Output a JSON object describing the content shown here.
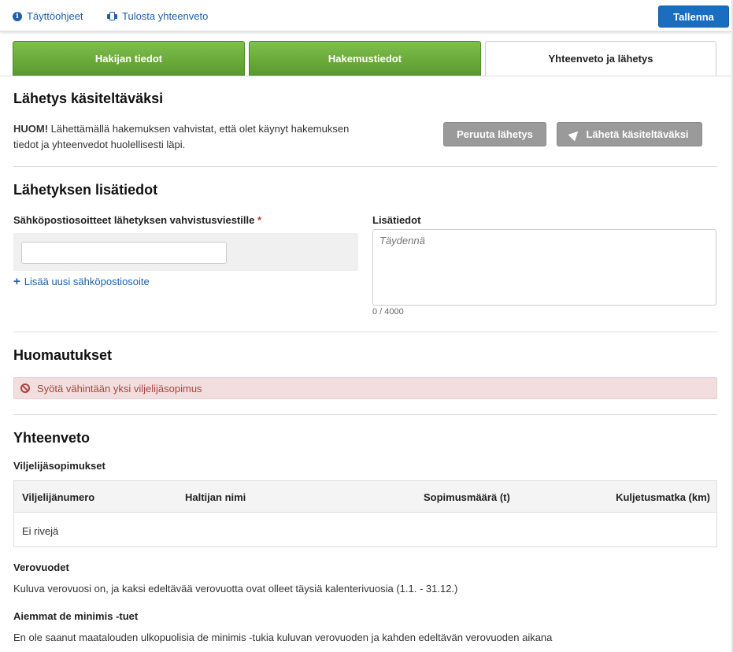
{
  "topbar": {
    "help_label": "Täyttöohjeet",
    "print_label": "Tulosta yhteenveto",
    "save_label": "Tallenna"
  },
  "tabs": [
    {
      "label": "Hakijan tiedot"
    },
    {
      "label": "Hakemustiedot"
    },
    {
      "label": "Yhteenveto ja lähetys"
    }
  ],
  "submit": {
    "title": "Lähetys käsiteltäväksi",
    "notice_strong": "HUOM!",
    "notice_text": " Lähettämällä hakemuksen vahvistat, että olet käynyt hakemuksen tiedot ja yhteenvedot huolellisesti läpi.",
    "cancel_label": "Peruuta lähetys",
    "send_label": "Lähetä käsiteltäväksi"
  },
  "extra": {
    "title": "Lähetyksen lisätiedot",
    "email_label": "Sähköpostiosoitteet lähetyksen vahvistusviestille",
    "required_mark": "*",
    "email_value": "",
    "add_email_label": "Lisää uusi sähköpostiosoite",
    "info_label": "Lisätiedot",
    "info_placeholder": "Täydennä",
    "counter": "0 / 4000"
  },
  "remarks": {
    "title": "Huomautukset",
    "error_text": "Syötä vähintään yksi viljelijäsopimus"
  },
  "summary": {
    "title": "Yhteenveto",
    "contracts_title": "Viljelijäsopimukset",
    "columns": [
      "Viljelijänumero",
      "Haltijan nimi",
      "Sopimusmäärä (t)",
      "Kuljetusmatka (km)"
    ],
    "empty_text": "Ei rivejä",
    "tax_title": "Verovuodet",
    "tax_text": "Kuluva verovuosi on, ja kaksi edeltävää verovuotta ovat olleet täysiä kalenterivuosia (1.1. - 31.12.)",
    "deminimis_title": "Aiemmat de minimis -tuet",
    "deminimis_text": "En ole saanut maatalouden ulkopuolisia de minimis -tukia kuluvan verovuoden ja kahden edeltävän verovuoden aikana"
  },
  "colors": {
    "link": "#1f5fa8",
    "primary": "#1a6ec2",
    "tab_green": "#6aaa3a",
    "error_bg": "#f2dede",
    "error_text": "#a94442"
  }
}
